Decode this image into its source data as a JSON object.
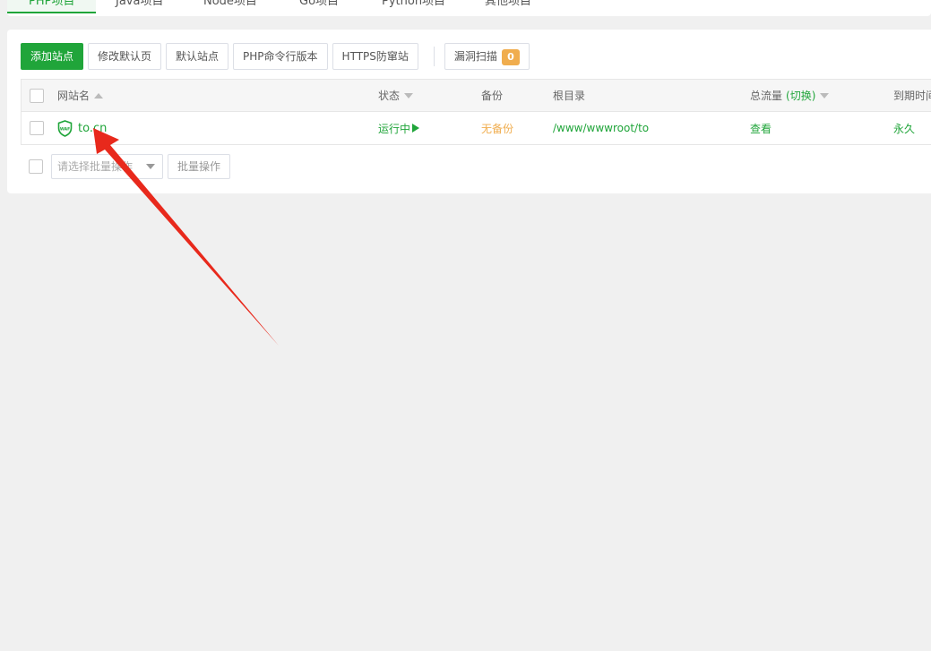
{
  "project_tabs": [
    {
      "label": "PHP项目",
      "active": true
    },
    {
      "label": "Java项目",
      "active": false
    },
    {
      "label": "Node项目",
      "active": false
    },
    {
      "label": "Go项目",
      "active": false
    },
    {
      "label": "Python项目",
      "active": false
    },
    {
      "label": "其他项目",
      "active": false
    }
  ],
  "toolbar": {
    "add_site": "添加站点",
    "edit_default_page": "修改默认页",
    "default_site": "默认站点",
    "php_cli_version": "PHP命令行版本",
    "https_guard": "HTTPS防窜站",
    "vuln_scan": "漏洞扫描",
    "vuln_count": "0"
  },
  "table": {
    "headers": {
      "site_name": "网站名",
      "status": "状态",
      "backup": "备份",
      "root_dir": "根目录",
      "traffic": "总流量",
      "traffic_switch": "(切换)",
      "expiry": "到期时间"
    },
    "rows": [
      {
        "waf_icon_text": "WAF",
        "site_name": "to.cn",
        "status": "运行中",
        "backup": "无备份",
        "root_dir": "/www/wwwroot/to",
        "traffic": "查看",
        "expiry": "永久"
      }
    ]
  },
  "batch": {
    "placeholder": "请选择批量操作",
    "button": "批量操作"
  },
  "colors": {
    "brand_green": "#20a53a",
    "warning_orange": "#f0ad4e",
    "annotation_red": "#e8291c"
  }
}
